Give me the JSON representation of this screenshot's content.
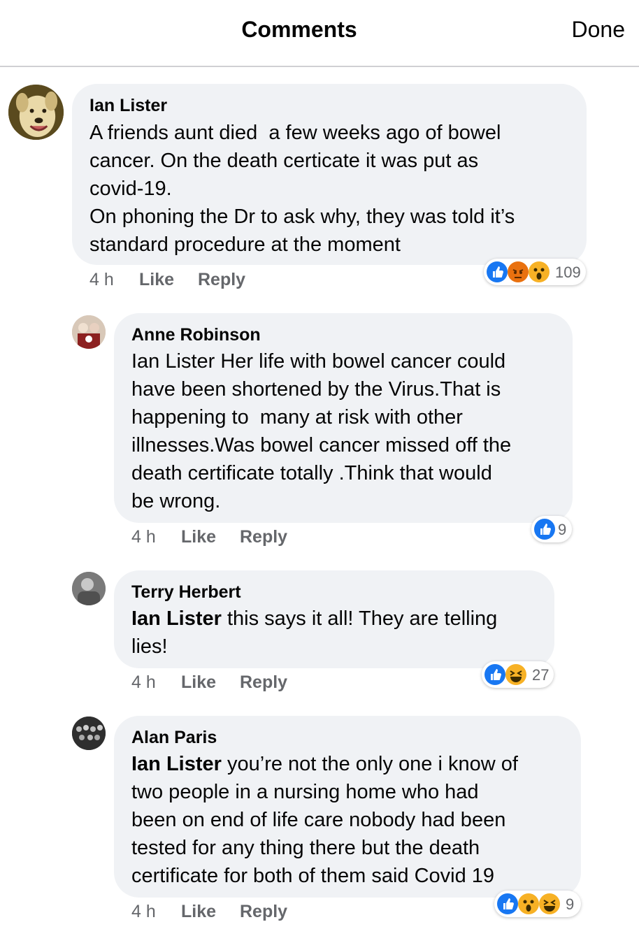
{
  "header": {
    "title": "Comments",
    "done_label": "Done"
  },
  "comments": [
    {
      "author": "Ian Lister",
      "lines": [
        "A friends aunt died  a few weeks ago of bowel",
        "cancer. On the death certicate it was put as",
        "covid-19.",
        "On phoning the Dr to ask why, they was told it’s",
        "standard procedure at the moment"
      ],
      "time": "4 h",
      "like": "Like",
      "reply": "Reply",
      "reactions": [
        "like-icon",
        "angry-icon",
        "wow-icon"
      ],
      "count": "109"
    },
    {
      "author": "Anne Robinson",
      "lines": [
        "Ian Lister Her life with bowel cancer could",
        "have been shortened by the Virus.That is",
        "happening to  many at risk with other",
        "illnesses.Was bowel cancer missed off the",
        "death certificate totally .Think that would",
        "be wrong."
      ],
      "time": "4 h",
      "like": "Like",
      "reply": "Reply",
      "reactions": [
        "like-icon"
      ],
      "count": "9"
    },
    {
      "author": "Terry Herbert",
      "mention": "Ian Lister",
      "lines": [
        " this says it all! They are telling",
        "lies!"
      ],
      "time": "4 h",
      "like": "Like",
      "reply": "Reply",
      "reactions": [
        "like-icon",
        "haha-icon"
      ],
      "count": "27"
    },
    {
      "author": "Alan Paris",
      "mention": "Ian Lister",
      "lines": [
        " you’re not the only one i know of",
        "two people in a nursing home who had",
        "been on end of life care nobody had been",
        "tested for any thing there but the death",
        "certificate for both of them said Covid 19"
      ],
      "time": "4 h",
      "like": "Like",
      "reply": "Reply",
      "reactions": [
        "like-icon",
        "wow-icon",
        "haha-icon"
      ],
      "count": "9"
    }
  ],
  "colors": {
    "bubble": "#f0f2f5",
    "like": "#1877f2",
    "angry": "#e9710f",
    "emoji_yellow": "#f7b125",
    "meta": "#65676b"
  }
}
